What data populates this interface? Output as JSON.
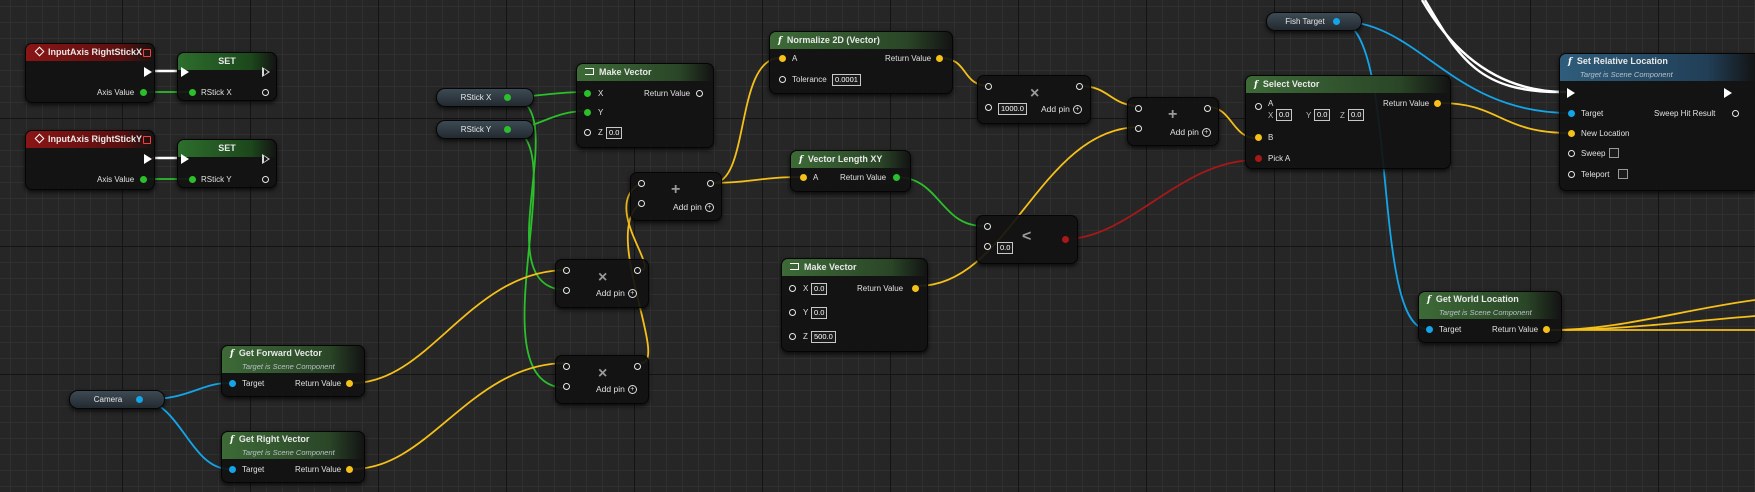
{
  "nodes": {
    "input_x": {
      "title": "InputAxis RightStickX",
      "pin_axis": "Axis Value"
    },
    "input_y": {
      "title": "InputAxis RightStickY",
      "pin_axis": "Axis Value"
    },
    "set_x": {
      "title": "SET",
      "pin": "RStick X"
    },
    "set_y": {
      "title": "SET",
      "pin": "RStick Y"
    },
    "get_rstick_x": {
      "label": "RStick X"
    },
    "get_rstick_y": {
      "label": "RStick Y"
    },
    "make_vector_1": {
      "title": "Make Vector",
      "x": "X",
      "y": "Y",
      "z": "Z",
      "z_value": "0.0",
      "out": "Return Value"
    },
    "normalize": {
      "title": "Normalize 2D (Vector)",
      "a": "A",
      "tolerance": "Tolerance",
      "tolerance_value": "0.0001",
      "out": "Return Value"
    },
    "mult_1": {
      "symbol": "×",
      "value": "1000.0",
      "add_pin": "Add pin"
    },
    "add_1": {
      "symbol": "+",
      "add_pin": "Add pin"
    },
    "add_2": {
      "symbol": "+",
      "add_pin": "Add pin"
    },
    "mult_2": {
      "symbol": "×",
      "add_pin": "Add pin"
    },
    "mult_3": {
      "symbol": "×",
      "add_pin": "Add pin"
    },
    "vector_length": {
      "title": "Vector Length XY",
      "a": "A",
      "out": "Return Value"
    },
    "less": {
      "symbol": "<",
      "value": "0.0"
    },
    "make_vector_2": {
      "title": "Make Vector",
      "x": "X",
      "y": "Y",
      "z": "Z",
      "x_value": "0.0",
      "y_value": "0.0",
      "z_value": "500.0",
      "out": "Return Value"
    },
    "select_vector": {
      "title": "Select Vector",
      "a": "A",
      "b": "B",
      "pick_a": "Pick A",
      "ax": "X",
      "ay": "Y",
      "az": "Z",
      "ax_value": "0.0",
      "ay_value": "0.0",
      "az_value": "0.0",
      "out": "Return Value"
    },
    "fish_target": {
      "label": "Fish Target"
    },
    "camera": {
      "label": "Camera"
    },
    "get_forward": {
      "title": "Get Forward Vector",
      "subtitle": "Target is Scene Component",
      "target": "Target",
      "out": "Return Value"
    },
    "get_right": {
      "title": "Get Right Vector",
      "subtitle": "Target is Scene Component",
      "target": "Target",
      "out": "Return Value"
    },
    "set_relative": {
      "title": "Set Relative Location",
      "subtitle": "Target is Scene Component",
      "target": "Target",
      "new_location": "New Location",
      "sweep": "Sweep",
      "teleport": "Teleport",
      "sweep_hit": "Sweep Hit Result"
    },
    "get_world": {
      "title": "Get World Location",
      "subtitle": "Target is Scene Component",
      "target": "Target",
      "out": "Return Value"
    }
  },
  "colors": {
    "vector_pin": "#f5c018",
    "float_pin": "#2bc02b",
    "object_pin": "#14a4e8",
    "bool_pin": "#a81818",
    "event_header": "#8a1515",
    "function_header": "#3d6a37",
    "target_function_header": "#2f5d7c"
  }
}
